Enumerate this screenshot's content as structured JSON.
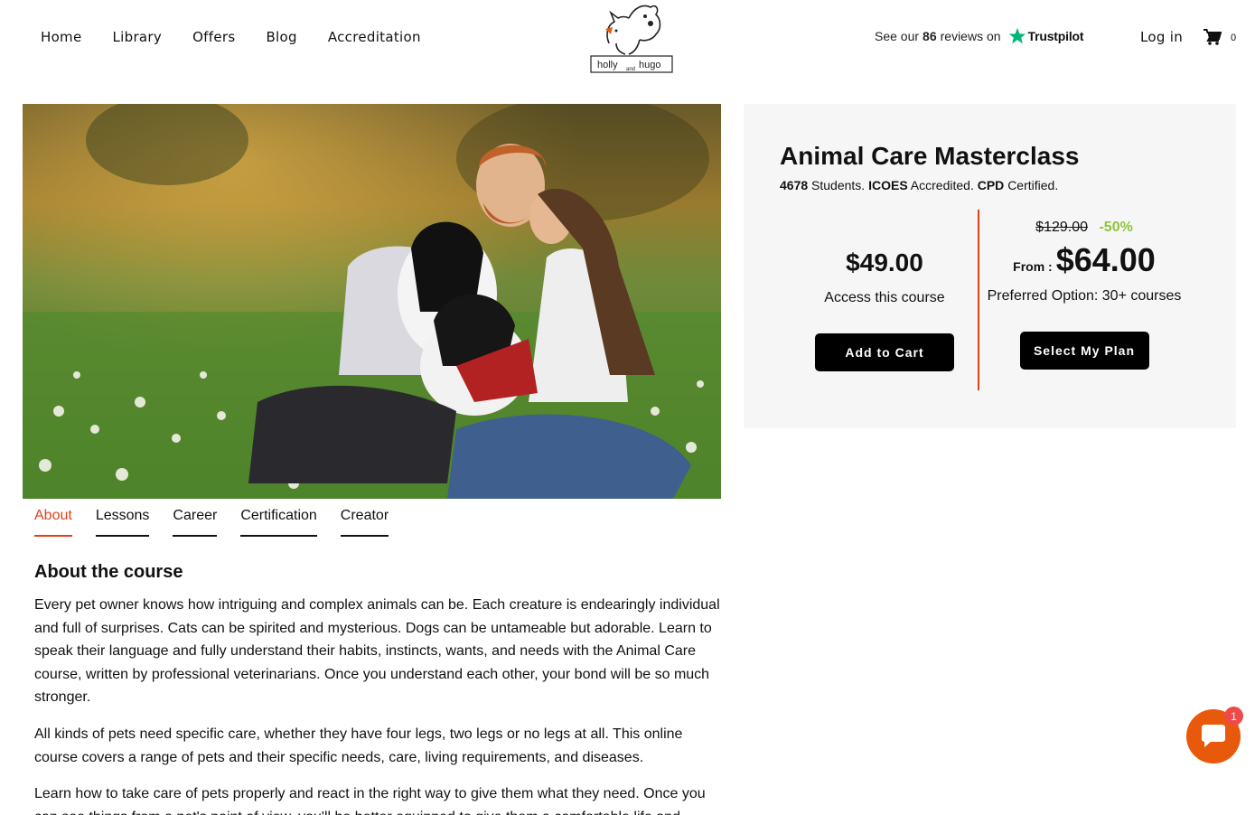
{
  "nav": {
    "items": [
      {
        "label": "Home"
      },
      {
        "label": "Library"
      },
      {
        "label": "Offers"
      },
      {
        "label": "Blog"
      },
      {
        "label": "Accreditation"
      }
    ],
    "login_label": "Log in",
    "cart_count": "0"
  },
  "logo": {
    "text_left": "holly",
    "text_mid": "and",
    "text_right": "hugo"
  },
  "trustpilot": {
    "prefix": "See our",
    "count": "86",
    "suffix": "reviews on",
    "brand": "Trustpilot",
    "star_color": "#00b67a"
  },
  "tabs": [
    {
      "label": "About",
      "active": true
    },
    {
      "label": "Lessons"
    },
    {
      "label": "Career"
    },
    {
      "label": "Certification"
    },
    {
      "label": "Creator"
    }
  ],
  "about": {
    "title": "About the course",
    "paragraphs": [
      "Every pet owner knows how intriguing and complex animals can be. Each creature is endearingly individual and full of surprises. Cats can be spirited and mysterious. Dogs can be untameable but adorable. Learn to speak their language and fully understand their habits, instincts, wants, and needs with the Animal Care course, written by professional veterinarians. Once you understand each other, your bond will be so much stronger.",
      "All kinds of pets need specific care, whether they have four legs, two legs or no legs at all. This online course covers a range of pets and their specific needs, care, living requirements, and diseases.",
      "Learn how to take care of pets properly and react in the right way to give them what they need. Once you can see things from a pet's point of view, you'll be better equipped to give them a comfortable life and"
    ]
  },
  "course": {
    "title": "Animal Care Masterclass",
    "students_count": "4678",
    "students_label": "Students.",
    "accreditor": "ICOES",
    "accredited_label": "Accredited.",
    "cert_body": "CPD",
    "certified_label": "Certified."
  },
  "pricing": {
    "single_price": "$49.00",
    "single_label": "Access this course",
    "add_to_cart": "Add to Cart",
    "old_price": "$129.00",
    "discount": "-50%",
    "from_label": "From :",
    "plan_price": "$64.00",
    "plan_label": "Preferred Option: 30+ courses",
    "select_plan": "Select My Plan"
  },
  "chat": {
    "badge_count": "1"
  },
  "colors": {
    "accent": "#e0401c",
    "discount": "#8fc23c",
    "chat": "#e8590c"
  }
}
